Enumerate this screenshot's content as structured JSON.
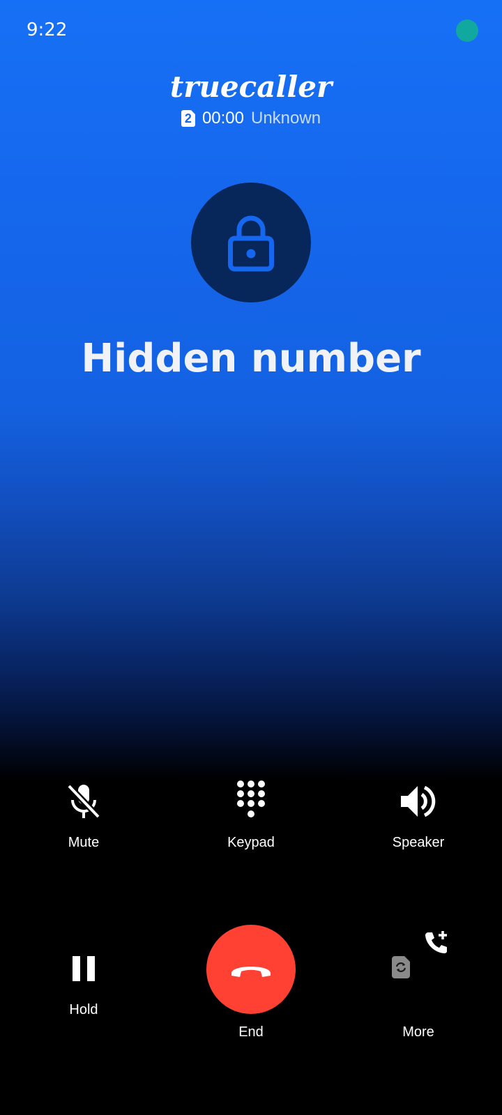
{
  "status_bar": {
    "time": "9:22"
  },
  "header": {
    "brand": "truecaller",
    "sim_slot": "2",
    "timer": "00:00",
    "call_status": "Unknown"
  },
  "caller": {
    "name": "Hidden number",
    "avatar_icon": "lock-icon"
  },
  "controls": {
    "mute_label": "Mute",
    "keypad_label": "Keypad",
    "speaker_label": "Speaker",
    "hold_label": "Hold",
    "end_label": "End",
    "more_label": "More"
  },
  "colors": {
    "background_top": "#1670f5",
    "avatar_bg": "#072659",
    "lock_icon": "#1467ee",
    "end_button": "#ff4133"
  }
}
